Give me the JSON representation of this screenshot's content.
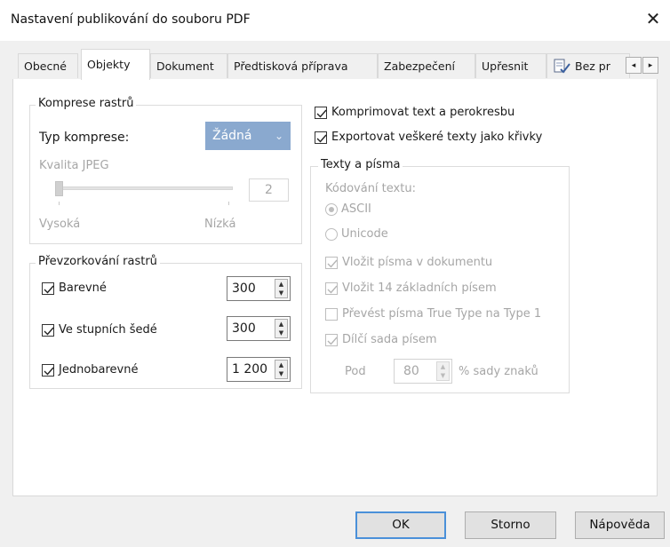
{
  "window": {
    "title": "Nastavení publikování do souboru PDF",
    "close_glyph": "✕"
  },
  "tabs": [
    {
      "label": "Obecné",
      "selected": false
    },
    {
      "label": "Objekty",
      "selected": true
    },
    {
      "label": "Dokument",
      "selected": false
    },
    {
      "label": "Předtisková příprava",
      "selected": false
    },
    {
      "label": "Zabezpečení",
      "selected": false
    },
    {
      "label": "Upřesnit",
      "selected": false
    },
    {
      "label": "Bez pr",
      "selected": false,
      "icon": "report-check-icon"
    }
  ],
  "tab_scroll": {
    "left": "◂",
    "right": "▸"
  },
  "compression": {
    "legend": "Komprese rastrů",
    "type_label": "Typ komprese:",
    "type_value": "Žádná",
    "jpeg_quality_label": "Kvalita JPEG",
    "jpeg_quality_value": "2",
    "slider_min_label": "Vysoká",
    "slider_max_label": "Nízká"
  },
  "resampling": {
    "legend": "Převzorkování rastrů",
    "rows": [
      {
        "label": "Barevné",
        "checked": true,
        "value": "300"
      },
      {
        "label": "Ve stupních šedé",
        "checked": true,
        "value": "300"
      },
      {
        "label": "Jednobarevné",
        "checked": true,
        "value": "1 200"
      }
    ]
  },
  "options": {
    "compress_text": "Komprimovat text a perokresbu",
    "export_curves": "Exportovat veškeré texty jako křivky"
  },
  "fonts": {
    "legend": "Texty a písma",
    "encoding_label": "Kódování textu:",
    "encoding_ascii": "ASCII",
    "encoding_unicode": "Unicode",
    "embed_fonts": "Vložit písma v dokumentu",
    "embed_14": "Vložit 14 základních písem",
    "convert_truetype": "Převést písma True Type na Type 1",
    "subset": "Dílčí sada písem",
    "under_label": "Pod",
    "under_value": "80",
    "under_suffix": "% sady znaků"
  },
  "buttons": {
    "ok": "OK",
    "cancel": "Storno",
    "help": "Nápověda"
  },
  "colors": {
    "dropdown_bg": "#8aa9cf",
    "default_button_border": "#4a90d9"
  }
}
